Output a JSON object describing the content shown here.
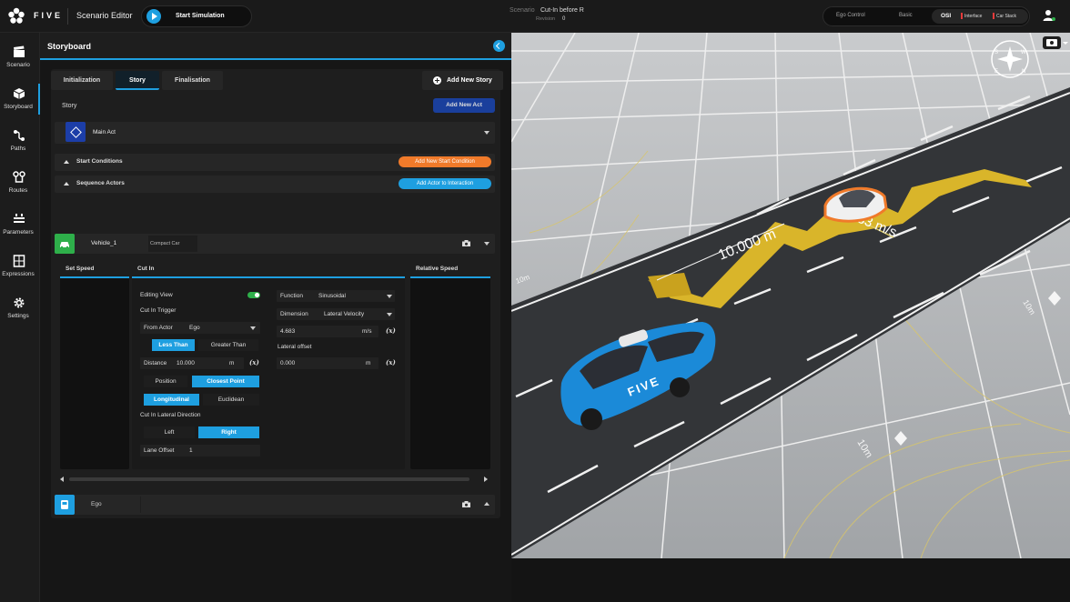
{
  "app": {
    "brand": "FIVE",
    "title": "Scenario Editor",
    "start_simulation": "Start Simulation"
  },
  "scenario": {
    "label": "Scenario",
    "name": "Cut-In before R",
    "revision_label": "Revision",
    "revision": "0"
  },
  "modes": {
    "ego_control": "Ego Control",
    "basic": "Basic",
    "osi": "OSI",
    "interface": "Interface",
    "car_stack": "Car Stack"
  },
  "nav": [
    {
      "label": "Scenario",
      "icon": "clapperboard-icon"
    },
    {
      "label": "Storyboard",
      "icon": "cube-icon",
      "active": true
    },
    {
      "label": "Paths",
      "icon": "path-icon"
    },
    {
      "label": "Routes",
      "icon": "route-icon"
    },
    {
      "label": "Parameters",
      "icon": "sliders-icon"
    },
    {
      "label": "Expressions",
      "icon": "calculator-icon"
    },
    {
      "label": "Settings",
      "icon": "gear-icon"
    }
  ],
  "panel": {
    "title": "Storyboard",
    "tabs": [
      "Initialization",
      "Story",
      "Finalisation"
    ],
    "active_tab": "Story",
    "add_story": "Add New Story",
    "story_label": "Story",
    "add_act": "Add New Act",
    "act_name": "Main Act",
    "start_conditions": "Start Conditions",
    "add_start_condition": "Add New Start Condition",
    "sequence_actors": "Sequence Actors",
    "add_actor": "Add Actor to Interaction",
    "vehicle_name": "Vehicle_1",
    "vehicle_type": "Compact Car",
    "ego_name": "Ego"
  },
  "columns": {
    "set_speed": "Set Speed",
    "cut_in": "Cut In",
    "relative_speed": "Relative Speed"
  },
  "cut_in": {
    "editing_view": "Editing View",
    "trigger_title": "Cut In Trigger",
    "from_actor_label": "From Actor",
    "from_actor_value": "Ego",
    "less_than": "Less Than",
    "greater_than": "Greater Than",
    "distance_label": "Distance",
    "distance_value": "10.000",
    "distance_unit": "m",
    "position": "Position",
    "closest_point": "Closest Point",
    "longitudinal": "Longitudinal",
    "euclidean": "Euclidean",
    "lateral_dir_title": "Cut In Lateral Direction",
    "left": "Left",
    "right": "Right",
    "lane_offset_label": "Lane Offset",
    "lane_offset_value": "1",
    "function_label": "Function",
    "function_value": "Sinusoidal",
    "dimension_label": "Dimension",
    "dimension_value": "Lateral Velocity",
    "velocity_value": "4.683",
    "velocity_unit": "m/s",
    "lateral_offset_label": "Lateral offset",
    "lateral_offset_value": "0.000",
    "lateral_offset_unit": "m",
    "fx": "(x)"
  },
  "viewport": {
    "distance_label": "10.000 m",
    "speed_label": "4.683 m/s",
    "grid_label_a": "10m",
    "grid_label_b": "10m",
    "grid_label_c": "10m",
    "car_text": "FIVE",
    "compass": [
      "S",
      "W",
      "N",
      "E"
    ]
  },
  "colors": {
    "accent": "#1e9fe0",
    "act": "#1a3f9c",
    "vehicle": "#2eaf4a",
    "warning": "#f07a2a"
  }
}
